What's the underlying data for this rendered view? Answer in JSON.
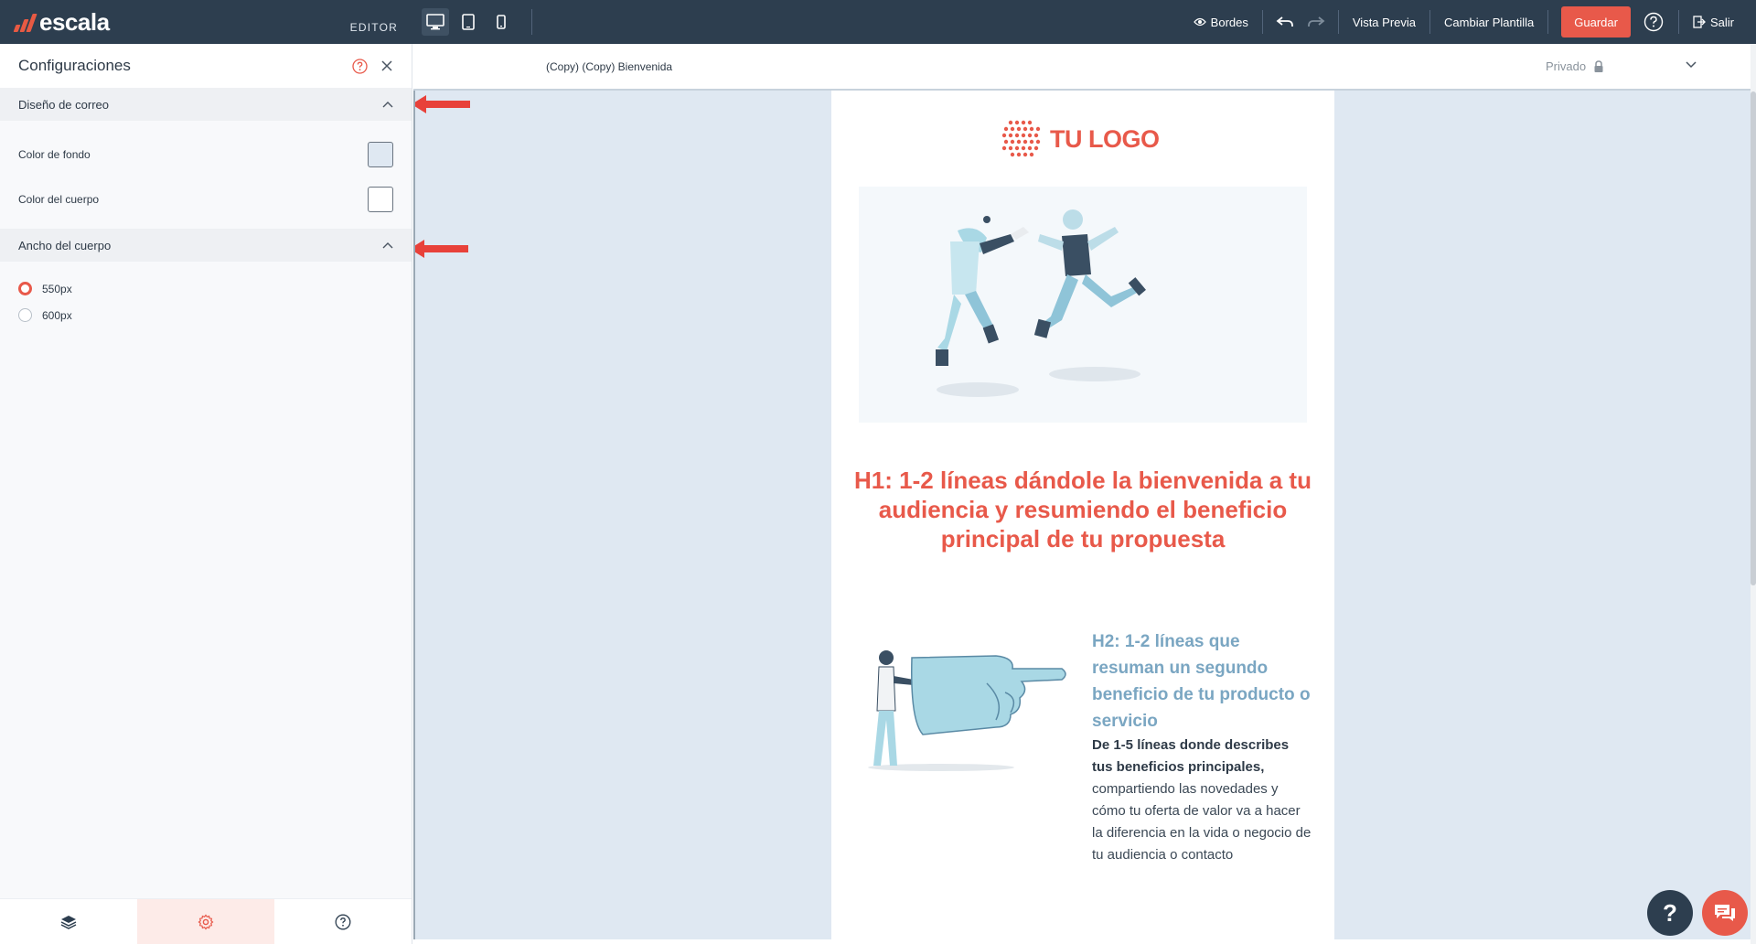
{
  "brand": {
    "name": "escala",
    "tag": "EDITOR"
  },
  "toolbar": {
    "borders_label": "Bordes",
    "preview_label": "Vista Previa",
    "change_template_label": "Cambiar Plantilla",
    "save_label": "Guardar",
    "exit_label": "Salir",
    "devices": [
      "desktop-icon",
      "tablet-icon",
      "mobile-icon"
    ]
  },
  "panel": {
    "title": "Configuraciones",
    "sections": [
      {
        "title": "Diseño de correo",
        "rows": [
          {
            "label": "Color de fondo",
            "color": "#dfe8f2"
          },
          {
            "label": "Color del cuerpo",
            "color": "#ffffff"
          }
        ]
      },
      {
        "title": "Ancho del cuerpo",
        "options": [
          {
            "label": "550px",
            "selected": true
          },
          {
            "label": "600px",
            "selected": false
          }
        ]
      }
    ],
    "tabs": [
      "layers-icon",
      "gear-icon",
      "help-icon"
    ]
  },
  "document": {
    "name": "(Copy) (Copy) Bienvenida",
    "privacy": "Privado"
  },
  "email": {
    "logo_text": "TU LOGO",
    "h1": "H1: 1-2 líneas dándole la bienvenida a tu audiencia y resumiendo el beneficio principal de tu propuesta",
    "h2": "H2: 1-2 líneas que resuman un segundo beneficio de tu producto o servicio",
    "body_bold": "De 1-5 líneas donde describes tus beneficios principales,",
    "body_rest": " compartiendo las novedades y cómo tu oferta de valor va a hacer la diferencia en la vida o negocio de tu audiencia o contacto"
  },
  "fab": {
    "help_label": "?"
  },
  "colors": {
    "accent": "#e8594a",
    "topbar": "#2d3e4f",
    "canvas_bg": "#dfe8f2",
    "h2": "#7aa6c2"
  }
}
